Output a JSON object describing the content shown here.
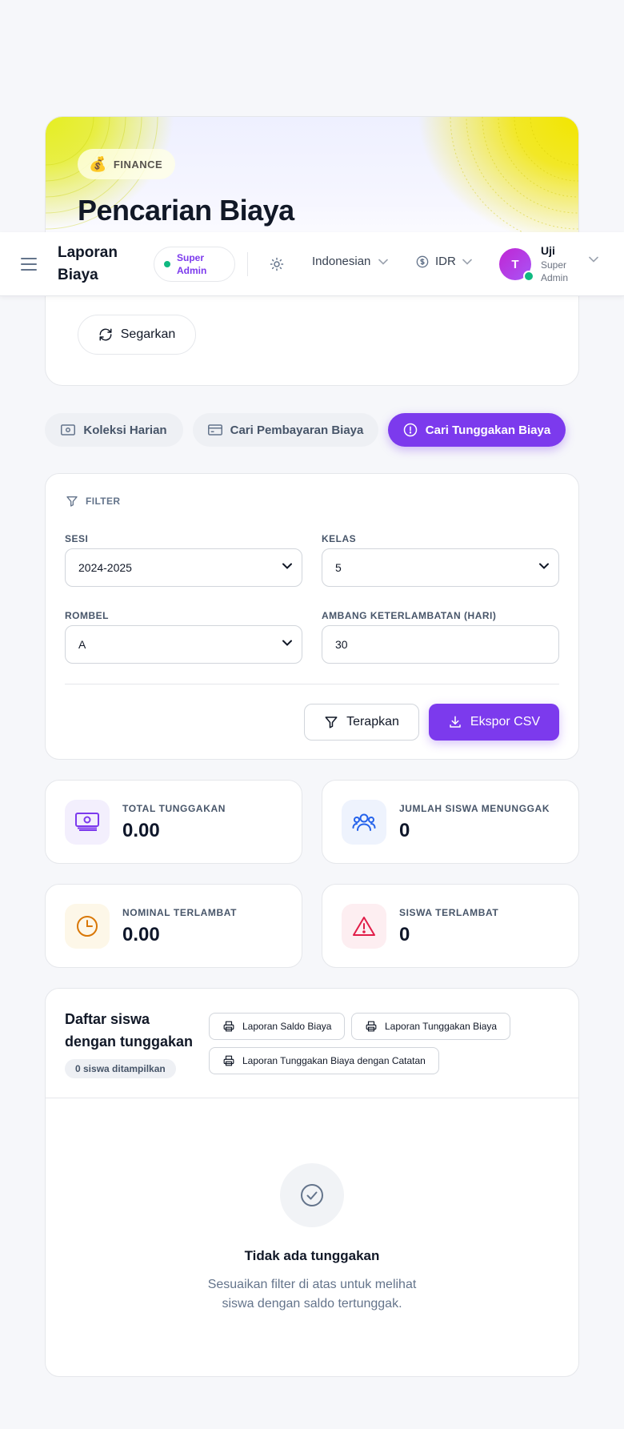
{
  "hero": {
    "badge_label": "FINANCE",
    "badge_icon": "money-bag-icon",
    "title": "Pencarian Biaya",
    "refresh_label": "Segarkan"
  },
  "topbar": {
    "page_title": "Laporan Biaya",
    "role_badge": "Super Admin",
    "language": "Indonesian",
    "currency": "IDR",
    "avatar_initial": "T",
    "user_name": "Uji",
    "user_role": "Super Admin"
  },
  "tabs": [
    {
      "label": "Koleksi Harian",
      "icon": "cash-icon",
      "active": false
    },
    {
      "label": "Cari Pembayaran Biaya",
      "icon": "credit-card-icon",
      "active": false
    },
    {
      "label": "Cari Tunggakan Biaya",
      "icon": "alert-circle-icon",
      "active": true
    }
  ],
  "filter": {
    "heading": "FILTER",
    "session_label": "SESI",
    "session_value": "2024-2025",
    "class_label": "KELAS",
    "class_value": "5",
    "group_label": "ROMBEL",
    "group_value": "A",
    "threshold_label": "AMBANG KETERLAMBATAN (HARI)",
    "threshold_value": "30",
    "apply_label": "Terapkan",
    "export_label": "Ekspor CSV"
  },
  "stats": [
    {
      "label": "TOTAL TUNGGAKAN",
      "value": "0.00",
      "icon": "banknote-icon",
      "color": "#7c3aed",
      "bg": "#f3effd"
    },
    {
      "label": "JUMLAH SISWA MENUNGGAK",
      "value": "0",
      "icon": "users-icon",
      "color": "#2563eb",
      "bg": "#eef3fd"
    },
    {
      "label": "NOMINAL TERLAMBAT",
      "value": "0.00",
      "icon": "clock-icon",
      "color": "#d97706",
      "bg": "#fdf7e8"
    },
    {
      "label": "SISWA TERLAMBAT",
      "value": "0",
      "icon": "warning-triangle-icon",
      "color": "#e11d48",
      "bg": "#fdeef1"
    }
  ],
  "list": {
    "title": "Daftar siswa dengan tunggakan",
    "count_text": "0 siswa ditampilkan",
    "report_buttons": [
      "Laporan Saldo Biaya",
      "Laporan Tunggakan Biaya",
      "Laporan Tunggakan Biaya dengan Catatan"
    ],
    "empty_title": "Tidak ada tunggakan",
    "empty_subtitle": "Sesuaikan filter di atas untuk melihat siswa dengan saldo tertunggak."
  },
  "colors": {
    "accent": "#7c3aed",
    "online": "#10b981"
  }
}
